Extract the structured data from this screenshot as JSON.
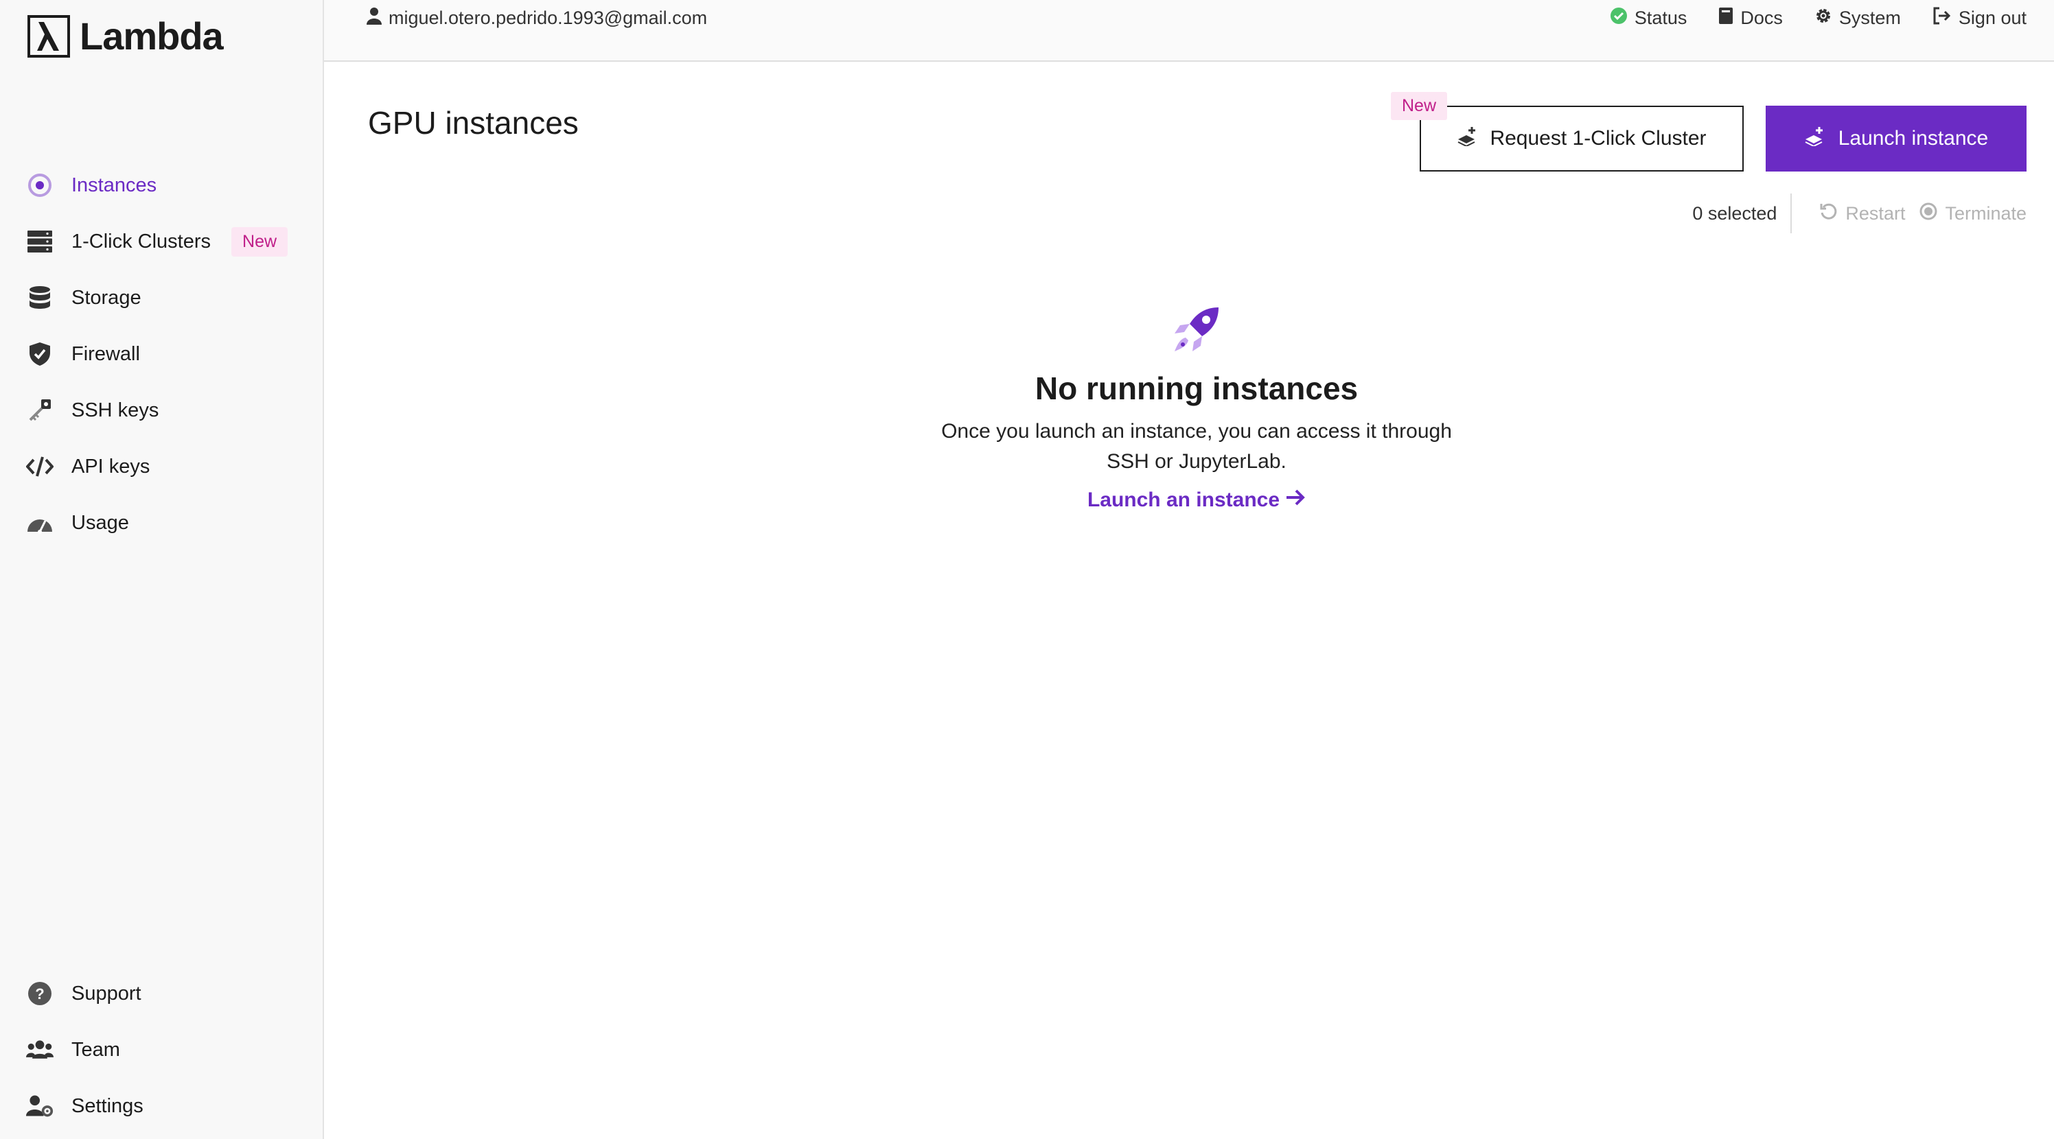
{
  "app": {
    "brand": "Lambda",
    "accent_color": "#6b2bc4",
    "badge_color": "#c0208a"
  },
  "sidebar": {
    "items": [
      {
        "label": "Instances",
        "icon": "instances-icon",
        "active": true
      },
      {
        "label": "1-Click Clusters",
        "icon": "server-rack-icon",
        "badge": "New"
      },
      {
        "label": "Storage",
        "icon": "database-icon"
      },
      {
        "label": "Firewall",
        "icon": "shield-check-icon"
      },
      {
        "label": "SSH keys",
        "icon": "key-icon"
      },
      {
        "label": "API keys",
        "icon": "code-icon"
      },
      {
        "label": "Usage",
        "icon": "gauge-icon"
      }
    ],
    "bottom_items": [
      {
        "label": "Support",
        "icon": "question-icon"
      },
      {
        "label": "Team",
        "icon": "users-icon"
      },
      {
        "label": "Settings",
        "icon": "user-gear-icon"
      }
    ]
  },
  "header": {
    "user_email": "miguel.otero.pedrido.1993@gmail.com",
    "links": [
      {
        "label": "Status",
        "icon": "check-circle-icon"
      },
      {
        "label": "Docs",
        "icon": "book-icon"
      },
      {
        "label": "System",
        "icon": "gear-icon"
      },
      {
        "label": "Sign out",
        "icon": "sign-out-icon"
      }
    ]
  },
  "main": {
    "title": "GPU instances",
    "request_cluster_label": "Request 1-Click Cluster",
    "request_cluster_badge": "New",
    "launch_label": "Launch instance",
    "selected_text": "0 selected",
    "restart_label": "Restart",
    "terminate_label": "Terminate",
    "empty": {
      "title": "No running instances",
      "description": "Once you launch an instance, you can access it through SSH or JupyterLab.",
      "link": "Launch an instance",
      "icon": "rocket-icon"
    }
  }
}
